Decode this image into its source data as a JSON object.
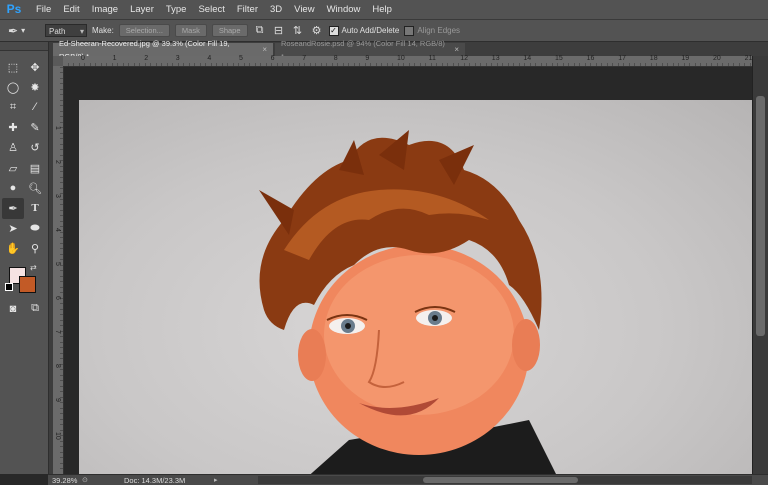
{
  "app": {
    "logo": "Ps",
    "accent": "#2fa3ff"
  },
  "menu": [
    "File",
    "Edit",
    "Image",
    "Layer",
    "Type",
    "Select",
    "Filter",
    "3D",
    "View",
    "Window",
    "Help"
  ],
  "options": {
    "mode_value": "Path",
    "make_label": "Make:",
    "selection_button": "Selection...",
    "mask_button": "Mask",
    "shape_button": "Shape",
    "auto_add_delete_label": "Auto Add/Delete",
    "auto_add_delete_checked": true,
    "align_edges_label": "Align Edges",
    "align_edges_checked": false
  },
  "tabs": [
    {
      "label": "Ed-Sheeran-Recovered.jpg @ 39.3% (Color Fill 19, RGB/8) *",
      "active": true
    },
    {
      "label": "RoseandRosie.psd @ 94% (Color Fill 14, RGB/8) *",
      "active": false
    }
  ],
  "ruler": {
    "h_ticks": [
      "0",
      "1",
      "2",
      "3",
      "4",
      "5",
      "6",
      "7",
      "8",
      "9",
      "10",
      "11",
      "12",
      "13",
      "14",
      "15",
      "16",
      "17",
      "18",
      "19",
      "20",
      "21"
    ],
    "v_ticks": [
      "1",
      "2",
      "3",
      "4",
      "5",
      "6",
      "7",
      "8",
      "9",
      "10"
    ]
  },
  "colors": {
    "foreground": "#f6e3e3",
    "background": "#c25a26"
  },
  "status": {
    "zoom": "39.28%",
    "doc": "Doc: 14.3M/23.3M"
  }
}
